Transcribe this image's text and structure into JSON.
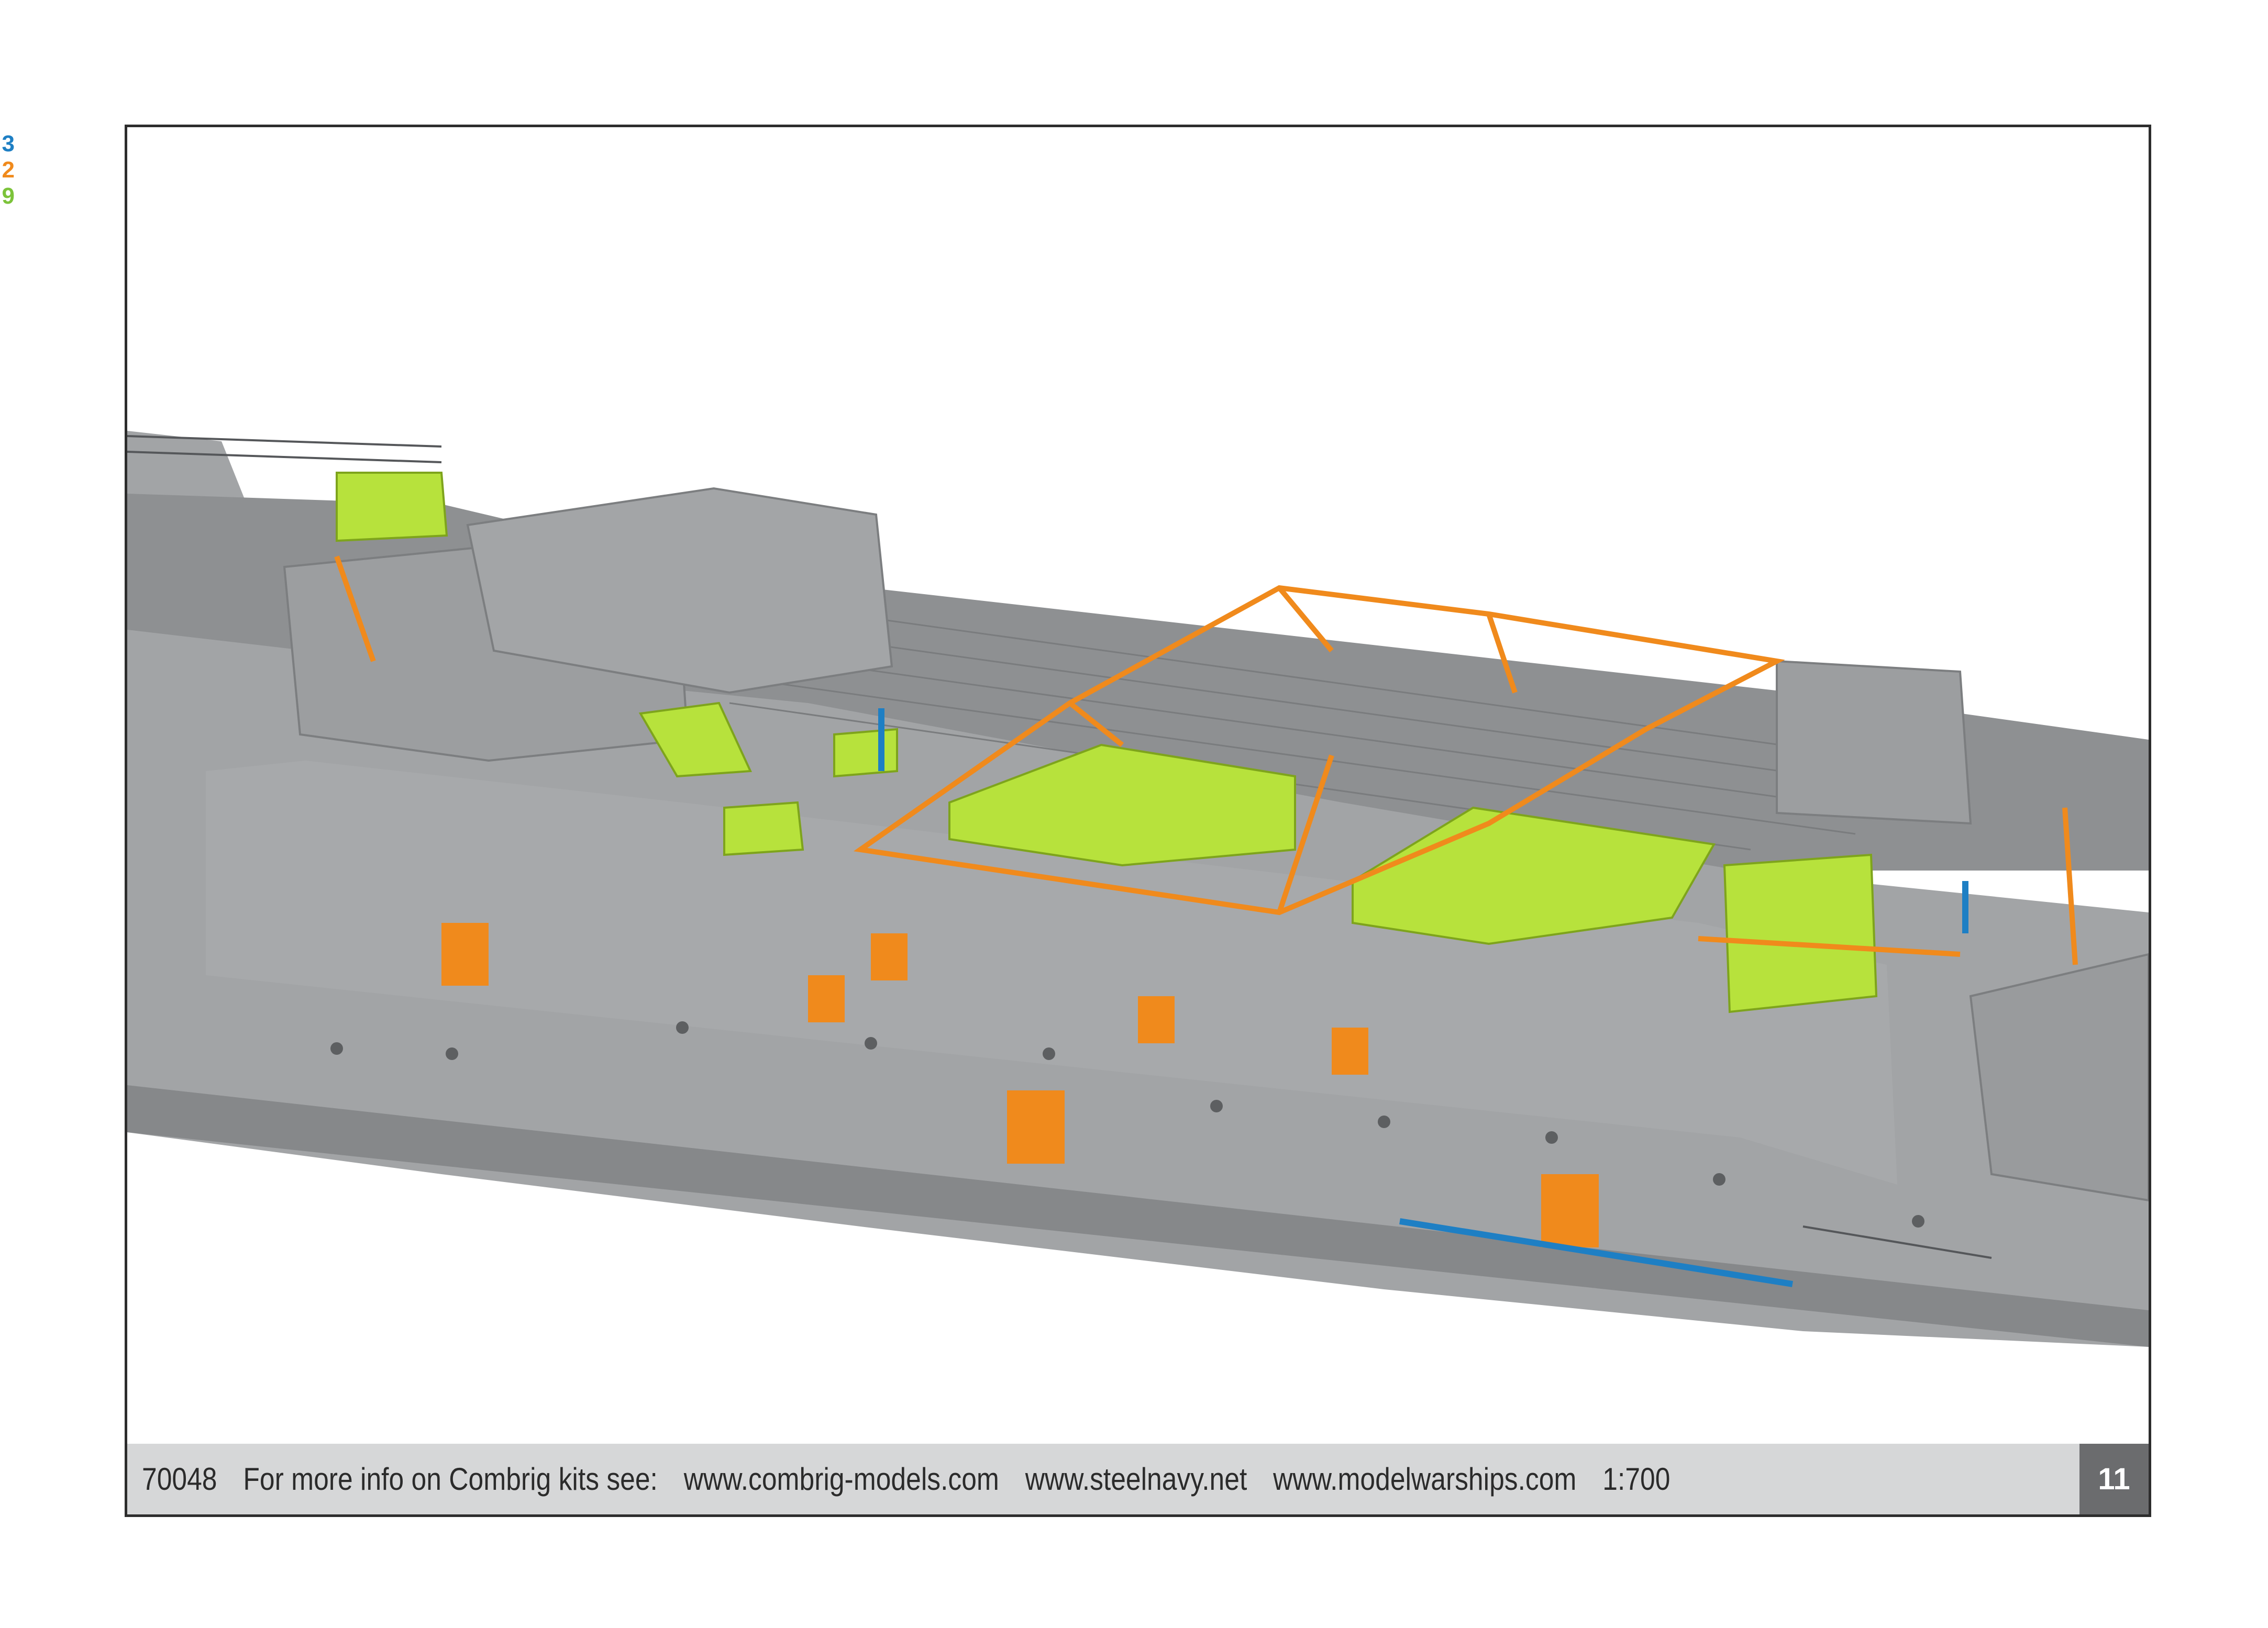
{
  "legend": [
    {
      "text": "3",
      "color": "#1e7fc4"
    },
    {
      "text": "2",
      "color": "#f08a1c"
    },
    {
      "text": "9",
      "color": "#7cc33a"
    }
  ],
  "colors": {
    "hull": "#9b9d9f",
    "deck": "#8e9092",
    "photo_etch_blue": "#1e7fc4",
    "photo_etch_orange": "#f08a1c",
    "resin_green": "#b7e23c",
    "footer_bg": "#d6d7d8",
    "page_number_bg": "#6b6c6e"
  },
  "footer": {
    "catalog_number": "70048",
    "info_text": "For more info on Combrig kits see:",
    "link_combrig": "www.combrig-models.com",
    "link_steelnavy": "www.steelnavy.net",
    "link_modelwarships": "www.modelwarships.com",
    "scale": "1:700",
    "page_number": "11"
  }
}
